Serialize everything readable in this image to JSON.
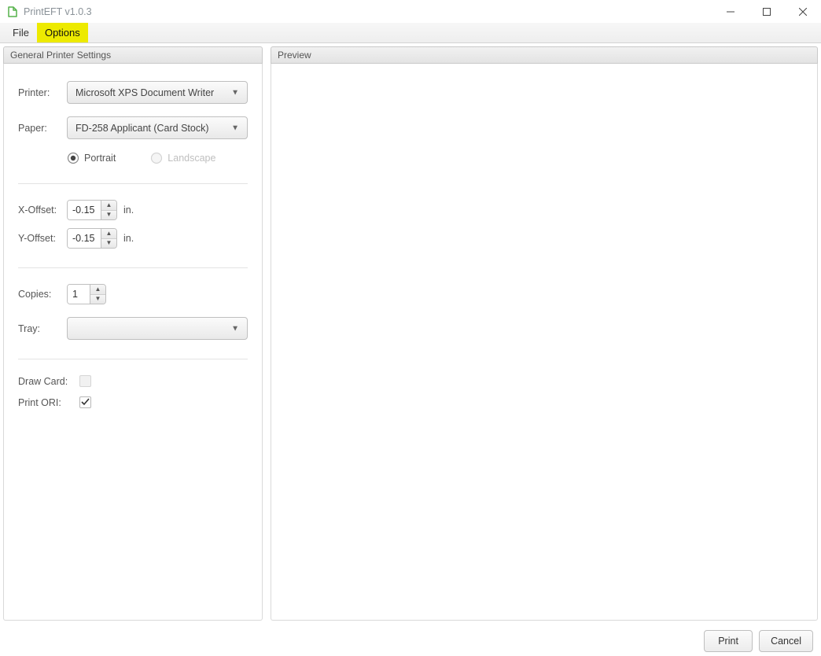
{
  "window": {
    "title": "PrintEFT v1.0.3"
  },
  "menu": {
    "file": "File",
    "options": "Options"
  },
  "panels": {
    "settings_title": "General Printer Settings",
    "preview_title": "Preview"
  },
  "labels": {
    "printer": "Printer:",
    "paper": "Paper:",
    "portrait": "Portrait",
    "landscape": "Landscape",
    "x_offset": "X-Offset:",
    "y_offset": "Y-Offset:",
    "unit_in": "in.",
    "copies": "Copies:",
    "tray": "Tray:",
    "draw_card": "Draw Card:",
    "print_ori": "Print ORI:"
  },
  "values": {
    "printer": "Microsoft XPS Document Writer",
    "paper": "FD-258 Applicant (Card Stock)",
    "x_offset": "-0.15",
    "y_offset": "-0.15",
    "copies": "1",
    "tray": ""
  },
  "footer": {
    "print": "Print",
    "cancel": "Cancel"
  }
}
